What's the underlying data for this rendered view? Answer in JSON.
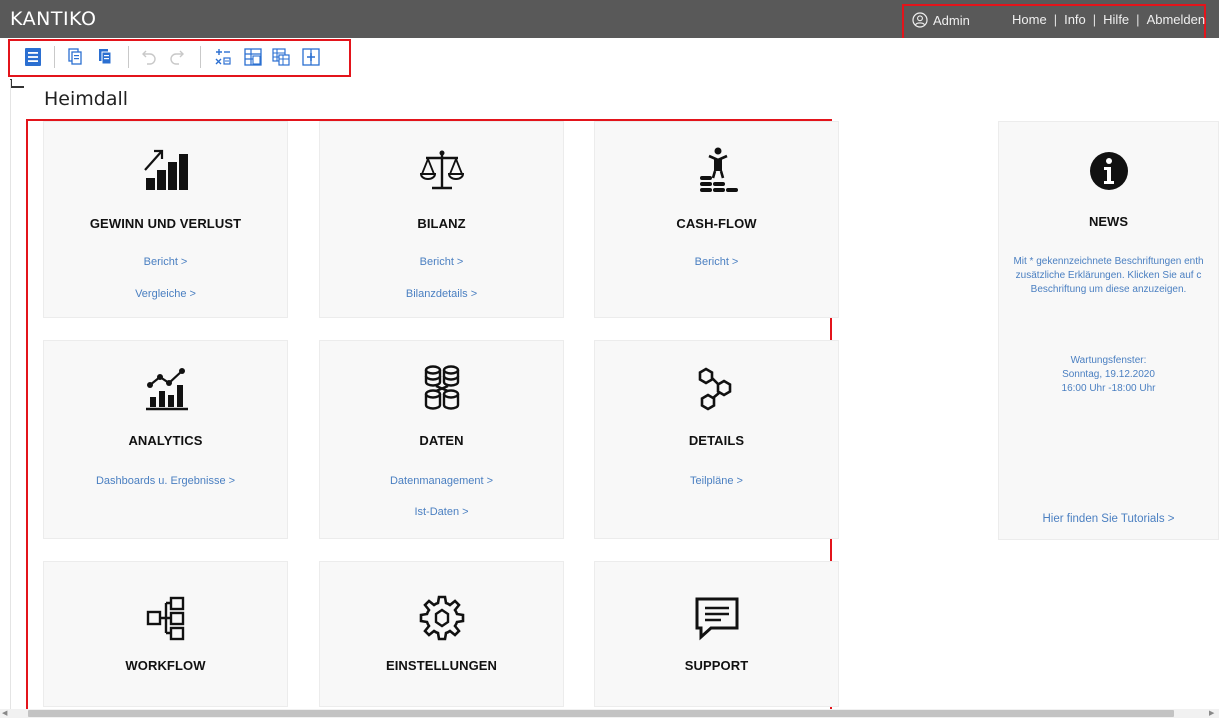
{
  "app": {
    "logo": "KANTIKO"
  },
  "header": {
    "user": "Admin",
    "links": [
      "Home",
      "Info",
      "Hilfe",
      "Abmelden"
    ],
    "separator": "|"
  },
  "toolbar": {
    "icons": [
      "menu-icon",
      "copy-icon",
      "paste-icon",
      "undo-icon",
      "redo-icon",
      "formula-icon",
      "table-icon",
      "table-copy-icon",
      "table-insert-icon"
    ]
  },
  "page": {
    "title": "Heimdall"
  },
  "tiles": [
    {
      "title": "GEWINN UND VERLUST",
      "icon": "growth-chart-icon",
      "links": [
        "Bericht >",
        "Vergleiche >"
      ]
    },
    {
      "title": "BILANZ",
      "icon": "balance-scale-icon",
      "links": [
        "Bericht >",
        "Bilanzdetails >"
      ]
    },
    {
      "title": "CASH-FLOW",
      "icon": "coins-person-icon",
      "links": [
        "Bericht >"
      ]
    },
    {
      "title": "ANALYTICS",
      "icon": "analytics-chart-icon",
      "links": [
        "Dashboards u. Ergebnisse >"
      ]
    },
    {
      "title": "DATEN",
      "icon": "database-network-icon",
      "links": [
        "Datenmanagement >",
        "Ist-Daten >"
      ]
    },
    {
      "title": "DETAILS",
      "icon": "nodes-icon",
      "links": [
        "Teilpläne >"
      ]
    },
    {
      "title": "WORKFLOW",
      "icon": "workflow-icon",
      "links": []
    },
    {
      "title": "EINSTELLUNGEN",
      "icon": "gear-icon",
      "links": []
    },
    {
      "title": "SUPPORT",
      "icon": "chat-bubble-icon",
      "links": []
    }
  ],
  "news": {
    "title": "NEWS",
    "icon": "info-icon",
    "text_lines": [
      "Mit * gekennzeichnete Beschriftungen enth",
      "zusätzliche Erklärungen. Klicken Sie auf c",
      "Beschriftung um diese anzuzeigen."
    ],
    "maintenance_lines": [
      "Wartungsfenster:",
      "Sonntag, 19.12.2020",
      "16:00 Uhr -18:00 Uhr"
    ],
    "tutorial_link": "Hier finden Sie Tutorials >"
  },
  "colors": {
    "topbar": "#595959",
    "accent": "#2b6fd1",
    "link": "#4a7fc1",
    "annotation": "#e3141b"
  }
}
